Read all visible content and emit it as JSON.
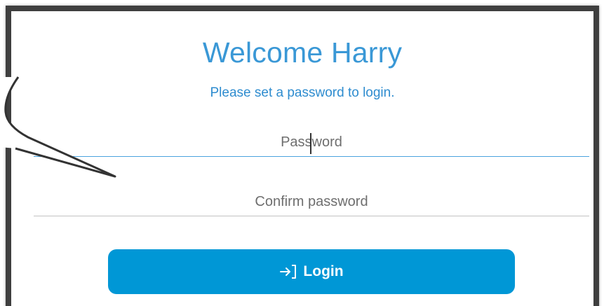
{
  "welcome": {
    "title": "Welcome Harry",
    "subtitle": "Please set a password to login."
  },
  "form": {
    "password_placeholder": "Password",
    "confirm_placeholder": "Confirm password",
    "login_label": "Login"
  },
  "colors": {
    "accent": "#3a98d6",
    "button": "#0097d6",
    "frame": "#3f3f3f",
    "active_underline": "#4aa3df",
    "inactive_underline": "#c2c2c2"
  },
  "icons": {
    "login": "sign-in-arrow-icon"
  }
}
